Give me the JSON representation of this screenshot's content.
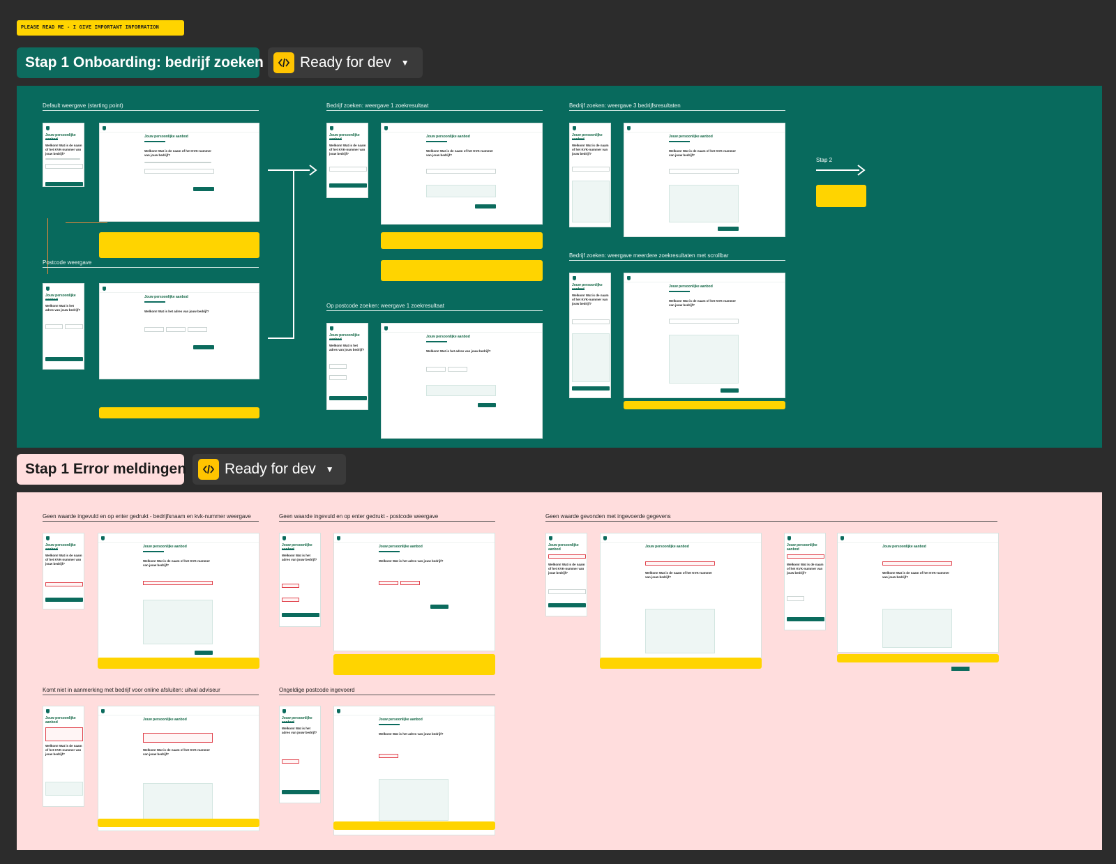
{
  "readme": "PLEASE READ ME - I GIVE IMPORTANT INFORMATION",
  "sections": [
    {
      "title": "Stap 1 Onboarding: bedrijf zoeken",
      "status": "Ready for dev"
    },
    {
      "title": "Stap 1 Error meldingen",
      "status": "Ready for dev"
    }
  ],
  "icons": {
    "status": "code-icon",
    "dropdown": "chevron-down-icon"
  },
  "onboarding_frames": [
    "Default weergave (starting point)",
    "Bedrijf zoeken: weergave 1 zoekresultaat",
    "Bedrijf zoeken: weergave 3 bedrijfsresultaten",
    "Postcode weergave",
    "Op postcode zoeken: weergave 1 zoekresultaat",
    "Bedrijf zoeken: weergave meerdere zoekresultaten met scrollbar"
  ],
  "step_label": "Stap 2",
  "error_frames": [
    "Geen waarde ingevuld en op enter gedrukt - bedrijfsnaam en kvk-nummer weergave",
    "Geen waarde ingevuld en op enter gedrukt - postcode weergave",
    "Geen waarde gevonden met ingevoerde gegevens",
    "Komt niet in aanmerking met bedrijf voor online afsluiten: uitval adviseur",
    "Ongeldige postcode ingevoerd"
  ],
  "mockup": {
    "title": "Jouw persoonlijke aanbod",
    "question_company": "Welkom! Wat is de naam of het KVK-nummer van jouw bedrijf?",
    "question_address": "Welkom! Wat is het adres van jouw bedrijf?"
  },
  "colors": {
    "background": "#2c2c2c",
    "green": "#086a5d",
    "pink": "#ffdddd",
    "note": "#ffd400",
    "status_icon": "#ffc400"
  }
}
